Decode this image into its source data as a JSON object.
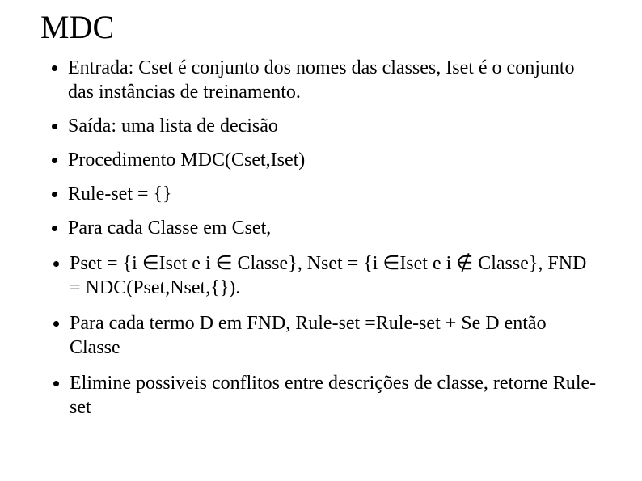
{
  "title": "MDC",
  "bullets": {
    "b1": "Entrada: Cset é conjunto dos nomes das classes, Iset é o conjunto das instâncias de treinamento.",
    "b2": "Saída: uma lista de decisão",
    "b3": "Procedimento MDC(Cset,Iset)",
    "b4": "Rule-set = {}",
    "b5": "Para cada Classe em Cset,",
    "sub": {
      "s1": "Pset = {i ∈Iset e i ∈ Classe}, Nset = {i ∈Iset e i ∉ Classe}, FND = NDC(Pset,Nset,{}).",
      "s2": "Para cada termo D em FND, Rule-set =Rule-set + Se D então Classe",
      "s3": "Elimine possiveis conflitos entre descrições de classe, retorne Rule-set"
    }
  }
}
